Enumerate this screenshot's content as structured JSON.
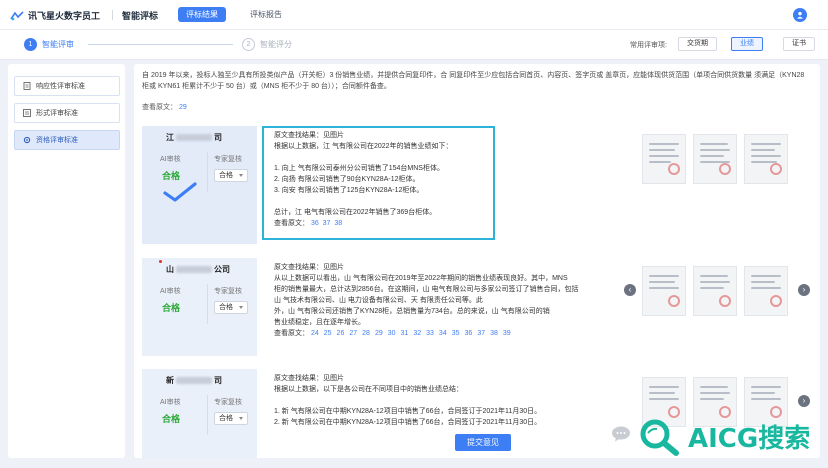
{
  "header": {
    "brand": "讯飞星火数字员工",
    "app_title": "智能评标",
    "tabs": [
      {
        "label": "评标结果",
        "active": true
      },
      {
        "label": "评标报告",
        "active": false
      }
    ]
  },
  "steps": [
    {
      "num": "1",
      "label": "智能评审"
    },
    {
      "num": "2",
      "label": "智能评分"
    }
  ],
  "quick": {
    "label": "常用评审项:",
    "items": [
      {
        "label": "交货期",
        "active": false
      },
      {
        "label": "业绩",
        "active": true
      },
      {
        "label": "证书",
        "active": false
      }
    ]
  },
  "sidebar": {
    "items": [
      {
        "label": "响应性评审标准",
        "active": false
      },
      {
        "label": "形式评审标准",
        "active": false
      },
      {
        "label": "资格评审标准",
        "active": true
      }
    ]
  },
  "requirement": {
    "text": "自 2019 年以来，投标人独至少具有所投类似产品（开关柜）3 份销售业绩，并提供合同复印件，合 同复印件至少应包括合同首页、内容页、签字页或 盖章页，应能体现供货范围（单项合同供货数量 须满足（KYN28 柜或 KYN61 柜累计不少于 50 台）或（MNS 柜不少于 80 台））；合同额件备查。",
    "ref_label": "查看原文：",
    "ref_num": "29"
  },
  "cards": [
    {
      "company": "江",
      "company_suffix": "司",
      "ai_label": "AI审核",
      "expert_label": "专家复核",
      "ai_result": "合格",
      "expert_value": "合格",
      "lines": [
        "原文查找结果：见图片",
        "根据以上数据，江             气有限公司在2022年的销售业绩如下：",
        "",
        "1. 向上           气有限公司泰州分公司销售了154台MNS柜体。",
        "2. 向扬             有限公司销售了90台KYN28A-12柜体。",
        "3. 向安             有限公司销售了125台KYN28A-12柜体。",
        "",
        "总计，江          电气有限公司在2022年销售了369台柜体。"
      ],
      "ref_label": "查看原文：",
      "refs": [
        "36",
        "37",
        "38"
      ]
    },
    {
      "company": "山",
      "company_suffix": "公司",
      "ai_label": "AI审核",
      "expert_label": "专家复核",
      "ai_result": "合格",
      "expert_value": "合格",
      "lines": [
        "原文查找结果：见图片",
        "从以上数据可以看出，山         气有限公司在2019年至2022年期间的销售业绩表现良好。其中，MNS",
        "柜的销售量最大，总计达到2856台。在这期间，山         电气有限公司与多家公司签订了销售合同，包括",
        "山          气技术有限公司、山          电力设备有限公司、天          有限责任公司等。此",
        "外，山          气有限公司还销售了KYN28柜，总销售量为734台。总的来说，山          气有限公司的销",
        "售业绩稳定，且在逐年增长。"
      ],
      "ref_label": "查看原文：",
      "refs": [
        "24",
        "25",
        "26",
        "27",
        "28",
        "29",
        "30",
        "31",
        "32",
        "33",
        "34",
        "35",
        "36",
        "37",
        "38",
        "39"
      ]
    },
    {
      "company": "新",
      "company_suffix": "司",
      "ai_label": "AI审核",
      "expert_label": "专家复核",
      "ai_result": "合格",
      "expert_value": "合格",
      "lines": [
        "原文查找结果：见图片",
        "根据以上数据，以下是各公司在不同项目中的销售业绩总结：",
        "",
        "1. 新          气有限公司在中期KYN28A-12项目中销售了66台，合同签订于2021年11月30日。",
        "2. 新          气有限公司在中期KYN28A-12项目中销售了66台，合同签订于2021年11月30日。"
      ]
    }
  ],
  "footer": {
    "submit_label": "提交意见"
  },
  "watermark": {
    "text": "AICG搜索"
  }
}
